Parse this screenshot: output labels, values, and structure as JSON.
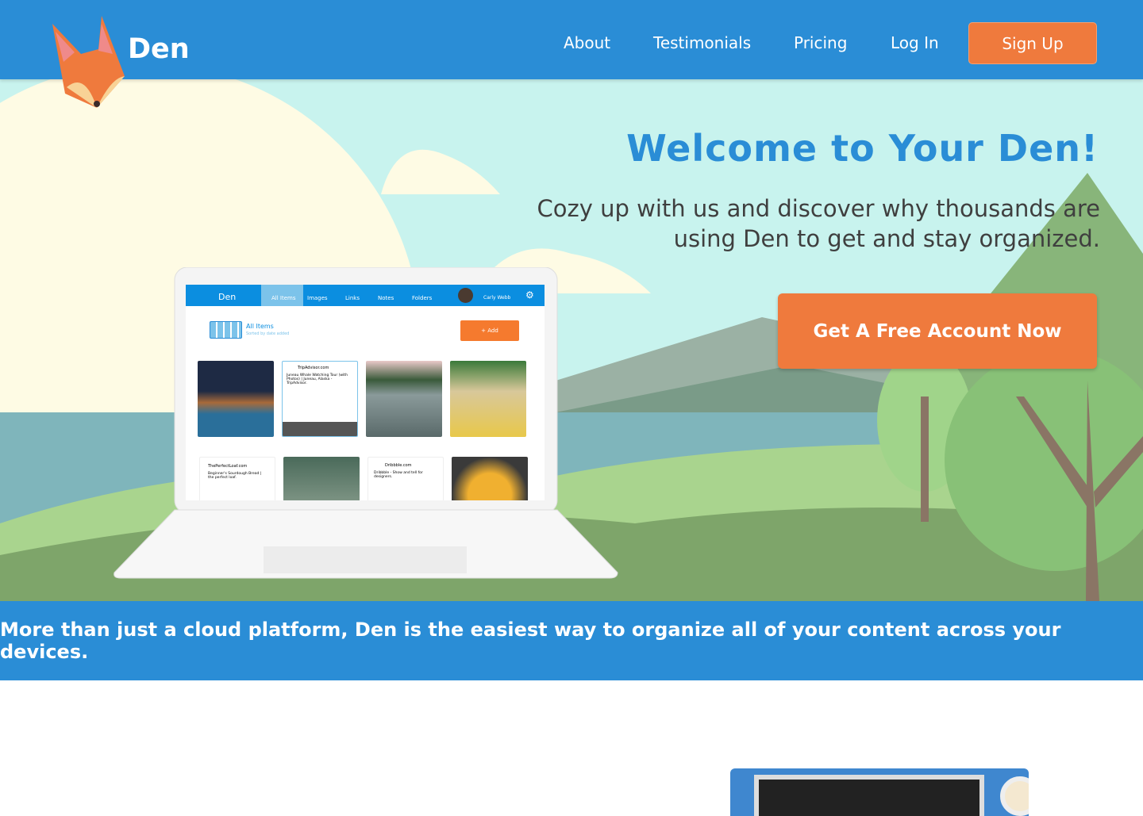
{
  "nav": {
    "brand": "Den",
    "links": [
      "About",
      "Testimonials",
      "Pricing",
      "Log In"
    ],
    "signup": "Sign Up"
  },
  "hero": {
    "title": "Welcome to Your Den!",
    "subtitle": "Cozy up with us and discover why thousands are using Den to get and stay organized.",
    "cta": "Get A Free Account Now"
  },
  "app": {
    "brand": "Den",
    "tabs": [
      "All Items",
      "Images",
      "Links",
      "Notes",
      "Folders"
    ],
    "user": "Carly Webb",
    "section_title": "All Items",
    "section_sub": "Sorted by date added",
    "add": "+ Add",
    "cards": {
      "trip_site": "TripAdvisor.com",
      "trip_text": "Juneau Whale Watching Tour (with Photos) | Juneau, Alaska - TripAdvisor.",
      "loaf_site": "ThePerfectLoaf.com",
      "loaf_text": "Beginner's Sourdough Bread | the perfect loaf.",
      "dribbble_site": "Dribbble.com",
      "dribbble_text": "Dribbble - Show and tell for designers."
    }
  },
  "band": {
    "text": "More than just a cloud platform, Den is the easiest way to organize all of your content across your devices."
  },
  "colors": {
    "primary": "#2a8dd6",
    "accent": "#ef7a3d",
    "sky": "#c8f3ee"
  }
}
